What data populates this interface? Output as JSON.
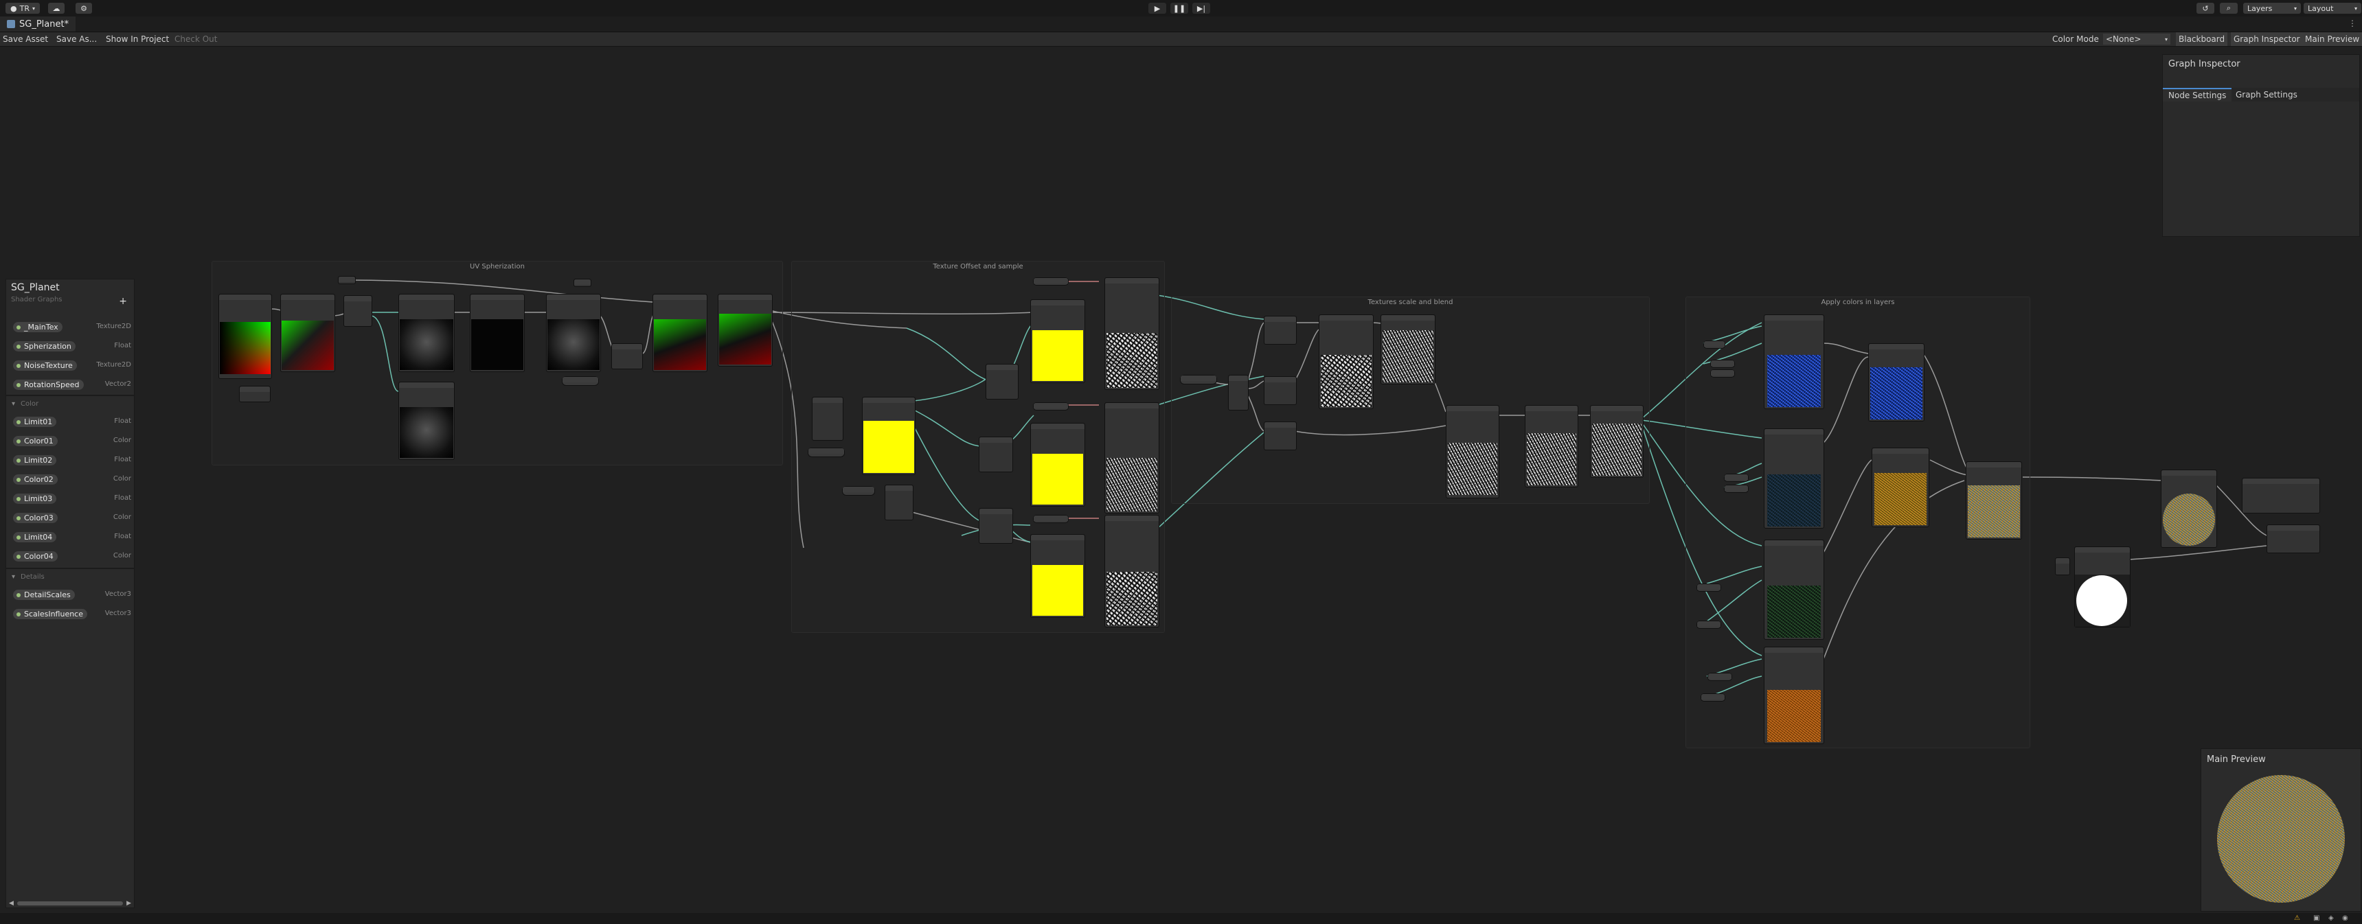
{
  "topbar": {
    "account_label": "TR",
    "cloud_icon": "cloud-icon",
    "settings_icon": "gear-icon",
    "play_icon": "play-icon",
    "pause_icon": "pause-icon",
    "step_icon": "step-icon",
    "history_icon": "history-icon",
    "search_icon": "search-icon",
    "layers_label": "Layers",
    "layout_label": "Layout"
  },
  "window": {
    "tab_title": "SG_Planet*",
    "tab_icon": "shadergraph-icon",
    "menu_icon": "more-vert-icon"
  },
  "toolbar": {
    "save_asset": "Save Asset",
    "save_as": "Save As...",
    "show_in_project": "Show In Project",
    "check_out": "Check Out",
    "color_mode_label": "Color Mode",
    "color_mode_value": "<None>",
    "blackboard": "Blackboard",
    "graph_inspector": "Graph Inspector",
    "main_preview": "Main Preview"
  },
  "blackboard": {
    "title": "SG_Planet",
    "subtitle": "Shader Graphs",
    "add_icon": "plus-icon",
    "properties": [
      {
        "name": "_MainTex",
        "type": "Texture2D"
      },
      {
        "name": "Spherization",
        "type": "Float"
      },
      {
        "name": "NoiseTexture",
        "type": "Texture2D"
      },
      {
        "name": "RotationSpeed",
        "type": "Vector2"
      }
    ],
    "categories": [
      {
        "name": "Color",
        "properties": [
          {
            "name": "Limit01",
            "type": "Float"
          },
          {
            "name": "Color01",
            "type": "Color"
          },
          {
            "name": "Limit02",
            "type": "Float"
          },
          {
            "name": "Color02",
            "type": "Color"
          },
          {
            "name": "Limit03",
            "type": "Float"
          },
          {
            "name": "Color03",
            "type": "Color"
          },
          {
            "name": "Limit04",
            "type": "Float"
          },
          {
            "name": "Color04",
            "type": "Color"
          }
        ]
      },
      {
        "name": "Details",
        "properties": [
          {
            "name": "DetailScales",
            "type": "Vector3"
          },
          {
            "name": "ScalesInfluence",
            "type": "Vector3"
          }
        ]
      }
    ]
  },
  "inspector": {
    "title": "Graph Inspector",
    "tabs": [
      "Node Settings",
      "Graph Settings"
    ]
  },
  "main_preview": {
    "title": "Main Preview"
  },
  "groups": [
    {
      "title": "UV Spherization"
    },
    {
      "title": "Texture Offset and sample"
    },
    {
      "title": "Textures scale and blend"
    },
    {
      "title": "Apply colors in layers"
    }
  ],
  "status": {
    "icons": [
      "status-icon-1",
      "status-icon-2",
      "status-icon-3",
      "status-icon-4",
      "status-icon-5"
    ]
  }
}
